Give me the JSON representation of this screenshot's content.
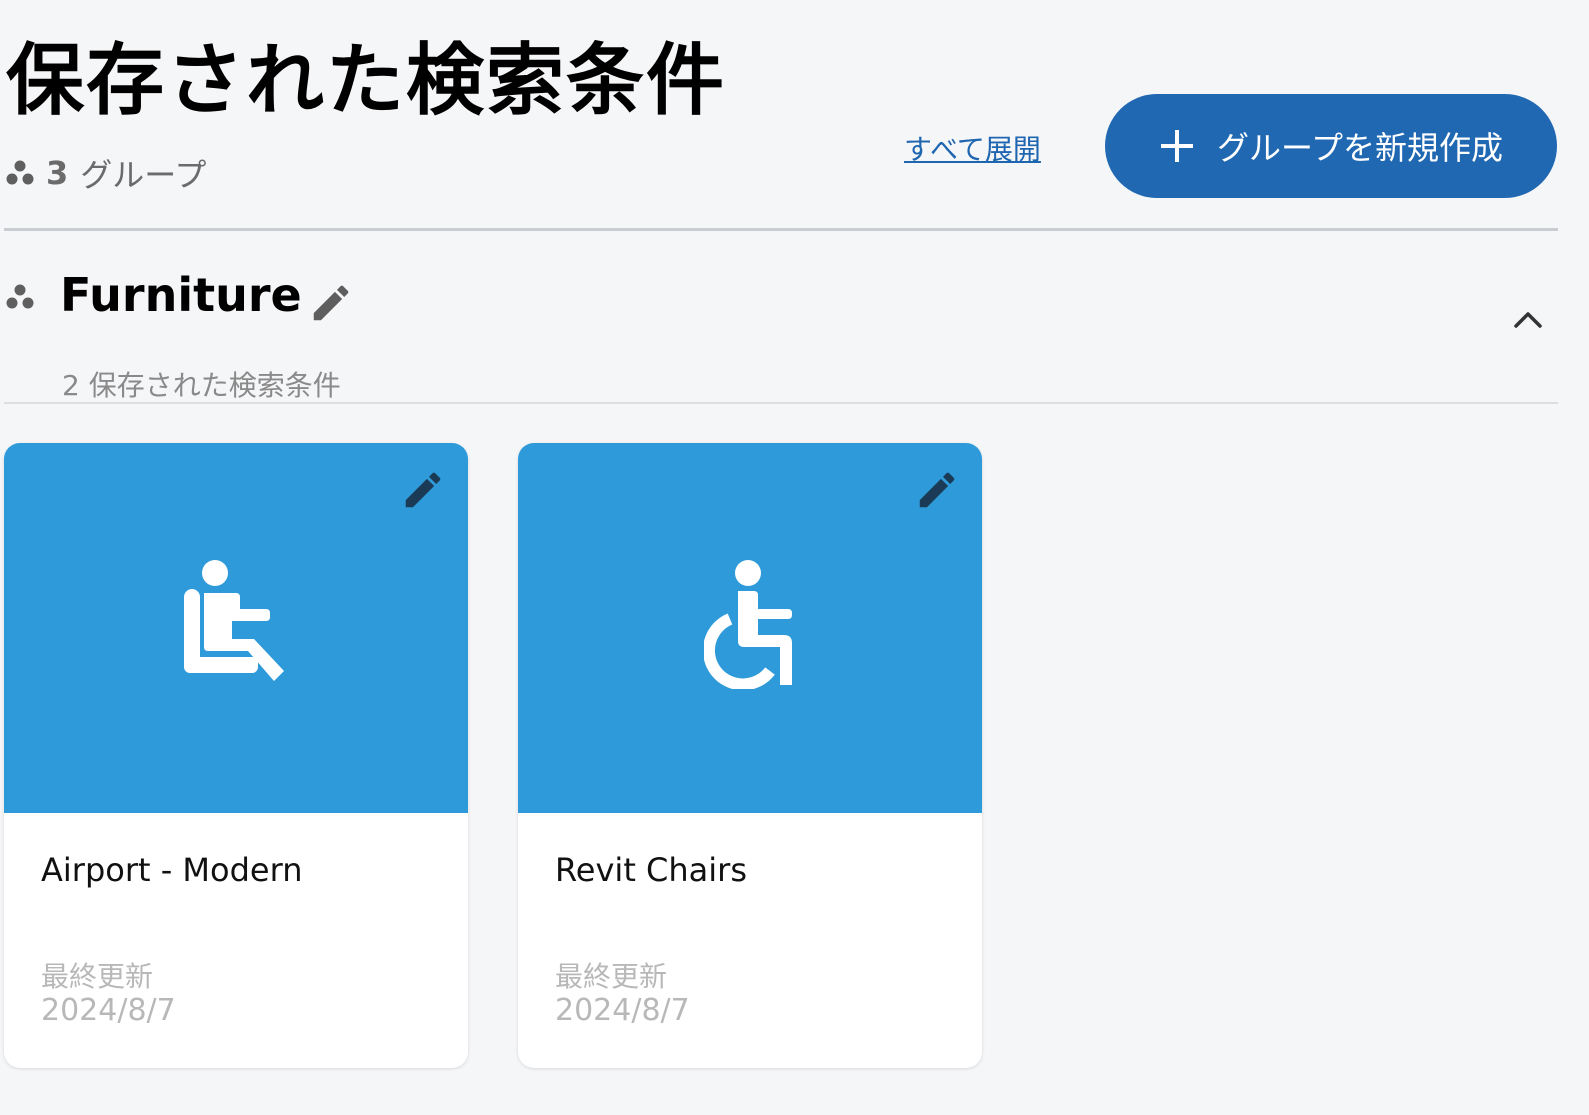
{
  "header": {
    "title": "保存された検索条件",
    "group_count": "3",
    "group_count_suffix": "グループ",
    "expand_all_label": "すべて展開",
    "new_group_label": "グループを新規作成",
    "accent_color": "#2168b3"
  },
  "group": {
    "name": "Furniture",
    "subtitle": "2 保存された検索条件"
  },
  "cards": [
    {
      "title": "Airport - Modern",
      "updated_label": "最終更新",
      "updated_date": "2024/8/7",
      "icon": "seated-person-icon",
      "media_color": "#2e9ad9"
    },
    {
      "title": "Revit Chairs",
      "updated_label": "最終更新",
      "updated_date": "2024/8/7",
      "icon": "wheelchair-icon",
      "media_color": "#2e9ad9"
    }
  ]
}
